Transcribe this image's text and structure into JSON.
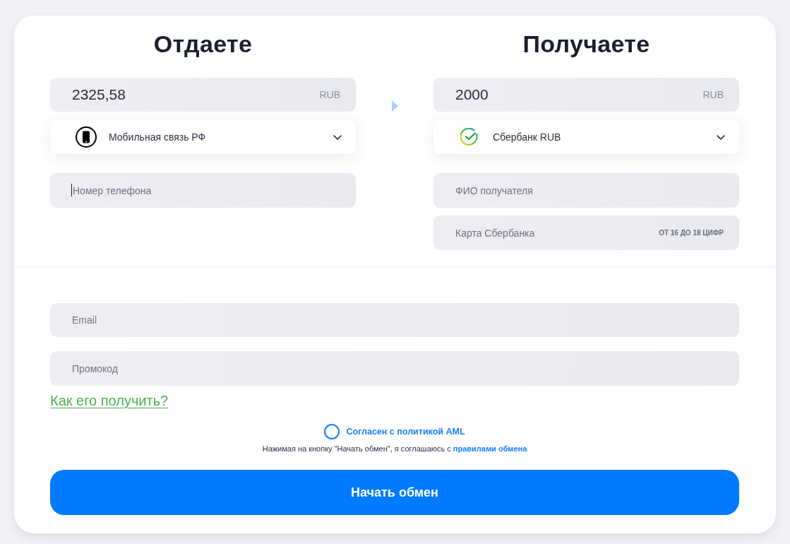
{
  "give": {
    "title": "Отдаете",
    "amount": {
      "value": "2325,58",
      "currency": "RUB"
    },
    "method": {
      "label": "Мобильная связь РФ"
    },
    "fields": [
      {
        "placeholder": "Номер телефона",
        "focused": true
      }
    ]
  },
  "receive": {
    "title": "Получаете",
    "amount": {
      "value": "2000",
      "currency": "RUB"
    },
    "method": {
      "label": "Сбербанк RUB"
    },
    "fields": [
      {
        "placeholder": "ФИО получателя",
        "focused": false
      },
      {
        "placeholder": "Карта Сбербанка",
        "hint": "ОТ 16 ДО 18 ЦИФР",
        "focused": false
      }
    ]
  },
  "contact": {
    "email": {
      "placeholder": "Email"
    },
    "promo": {
      "placeholder": "Промокод"
    },
    "promo_link": "Как его получить?"
  },
  "agreement": {
    "checkbox": {
      "label": "Согласен с политикой AML",
      "checked": false
    },
    "note": "Нажимая на кнопку \"Начать обмен\", я соглашаюсь с",
    "note_link": "правилами обмена"
  },
  "submit": "Начать обмен"
}
